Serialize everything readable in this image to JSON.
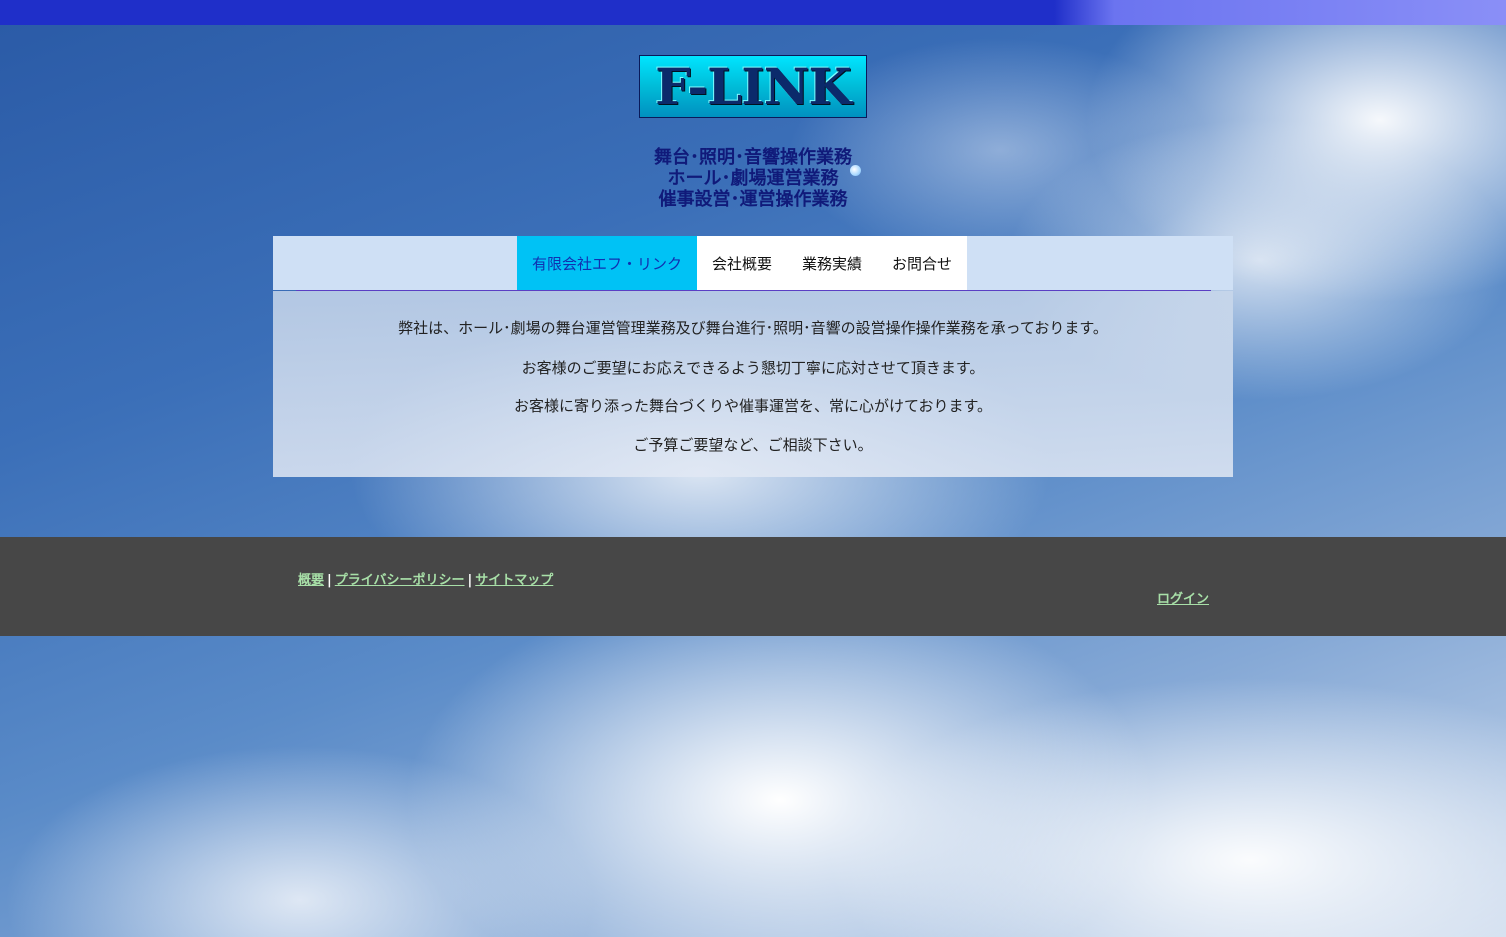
{
  "logo": {
    "text": "F-LINK"
  },
  "tagline": [
    "舞台･照明･音響操作業務",
    "ホール･劇場運営業務",
    "催事設営･運営操作業務"
  ],
  "nav": {
    "items": [
      {
        "label": "有限会社エフ・リンク",
        "active": true
      },
      {
        "label": "会社概要",
        "active": false
      },
      {
        "label": "業務実績",
        "active": false
      },
      {
        "label": "お問合せ",
        "active": false
      }
    ]
  },
  "content": {
    "paragraphs": [
      "弊社は、ホール･劇場の舞台運営管理業務及び舞台進行･照明･音響の設営操作操作業務を承っております。",
      "お客様のご要望にお応えできるよう懇切丁寧に応対させて頂きます。",
      "お客様に寄り添った舞台づくりや催事運営を、常に心がけております。",
      "ご予算ご要望など、ご相談下さい。"
    ]
  },
  "footer": {
    "links": [
      "概要",
      "プライバシーポリシー",
      "サイトマップ"
    ],
    "separator": "|",
    "login": "ログイン"
  },
  "colors": {
    "topbar": "#1f2fc9",
    "nav_active_bg": "#00c2f5",
    "nav_active_text": "#1030b0",
    "tagline": "#101a7a",
    "footer_bg": "#474747",
    "footer_link": "#a8e0a8"
  }
}
